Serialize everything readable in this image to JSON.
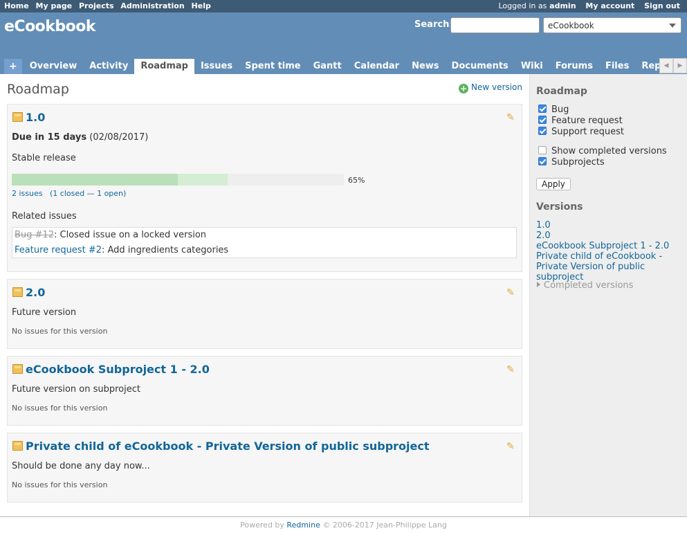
{
  "top_menu": {
    "left": [
      "Home",
      "My page",
      "Projects",
      "Administration",
      "Help"
    ],
    "logged_in_prefix": "Logged in as",
    "user": "admin",
    "my_account": "My account",
    "sign_out": "Sign out"
  },
  "header": {
    "title": "eCookbook",
    "search_label": "Search:",
    "search_value": "",
    "project_select": "eCookbook"
  },
  "tabs": [
    "+",
    "Overview",
    "Activity",
    "Roadmap",
    "Issues",
    "Spent time",
    "Gantt",
    "Calendar",
    "News",
    "Documents",
    "Wiki",
    "Forums",
    "Files",
    "Repository"
  ],
  "selected_tab": "Roadmap",
  "main": {
    "title": "Roadmap",
    "new_version": "New version"
  },
  "versions": [
    {
      "name": "1.0",
      "due_label": "Due in 15 days",
      "due_date": "(02/08/2017)",
      "description": "Stable release",
      "progress_closed": 0.5,
      "progress_done": 0.65,
      "progress_text": "65%",
      "issues_link": "2 issues",
      "issues_detail": "(1 closed — 1 open)",
      "related_label": "Related issues",
      "related": [
        {
          "link": "Bug #12",
          "text": ": Closed issue on a locked version",
          "closed": true
        },
        {
          "link": "Feature request #2",
          "text": ": Add ingredients categories",
          "closed": false
        }
      ]
    },
    {
      "name": "2.0",
      "description": "Future version",
      "no_issues": "No issues for this version"
    },
    {
      "name": "eCookbook Subproject 1 - 2.0",
      "description": "Future version on subproject",
      "no_issues": "No issues for this version"
    },
    {
      "name": "Private child of eCookbook - Private Version of public subproject",
      "description": "Should be done any day now...",
      "no_issues": "No issues for this version"
    }
  ],
  "sidebar": {
    "roadmap_title": "Roadmap",
    "trackers": [
      {
        "label": "Bug",
        "checked": true
      },
      {
        "label": "Feature request",
        "checked": true
      },
      {
        "label": "Support request",
        "checked": true
      }
    ],
    "show_completed": {
      "label": "Show completed versions",
      "checked": false
    },
    "subprojects": {
      "label": "Subprojects",
      "checked": true
    },
    "apply": "Apply",
    "versions_title": "Versions",
    "version_links": [
      "1.0",
      "2.0",
      "eCookbook Subproject 1 - 2.0",
      "Private child of eCookbook - Private Version of public subproject"
    ],
    "completed_versions": "Completed versions"
  },
  "footer": {
    "prefix": "Powered by",
    "link": "Redmine",
    "suffix": "© 2006-2017 Jean-Philippe Lang"
  },
  "colors": {
    "header": "#628DB6",
    "top_menu": "#3E5B76",
    "link": "#116699",
    "progress_closed": "#BAE0BA",
    "progress_done": "#D4EDD4"
  }
}
